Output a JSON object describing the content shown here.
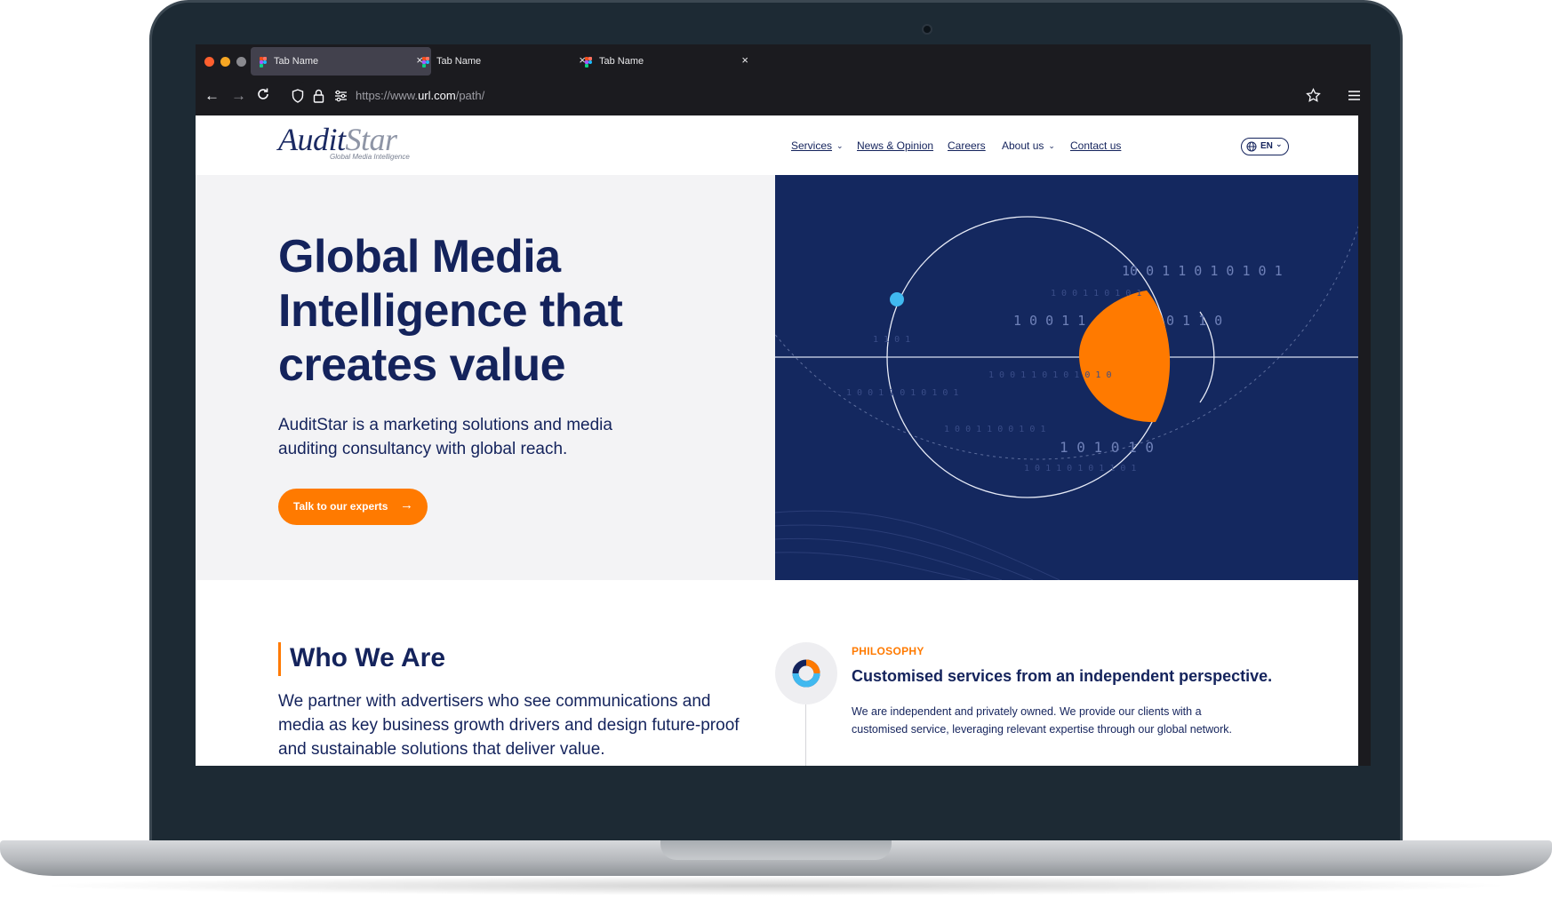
{
  "browser": {
    "tabs": [
      {
        "label": "Tab Name",
        "active": true
      },
      {
        "label": "Tab Name",
        "active": false
      },
      {
        "label": "Tab Name",
        "active": false
      }
    ],
    "close_glyph": "×",
    "url_prefix": "https://www.",
    "url_domain": "url.com",
    "url_path": "/path/",
    "traffic_lights": [
      "#ff5f2e",
      "#f6a623",
      "#8a8a8f"
    ]
  },
  "site": {
    "logo": {
      "main_a": "Audit",
      "main_b": "Star",
      "tagline": "Global Media Intelligence"
    },
    "nav": {
      "services": "Services",
      "news": "News & Opinion",
      "careers": "Careers",
      "about": "About us",
      "contact": "Contact us",
      "lang": "EN"
    },
    "hero": {
      "title": "Global Media Intelligence that creates value",
      "subtitle": "AuditStar is a marketing solutions and media auditing consultancy with global reach.",
      "cta": "Talk to our experts",
      "binary_rows": [
        "10 0 1  1 0  1 0 1 0 1",
        "1 0 0 1  1",
        "0 1   1     0",
        "1    0    1    0    1    0"
      ]
    },
    "who": {
      "title": "Who We Are",
      "text": "We partner with advertisers who see communications and media as key business growth drivers and design future-proof and sustainable solutions that deliver value."
    },
    "philosophy": {
      "kicker": "PHILOSOPHY",
      "title": "Customised services from an independent perspective.",
      "text": "We are independent and privately owned. We provide our clients with a customised service, leveraging relevant expertise through our global network."
    }
  },
  "colors": {
    "navy": "#14235c",
    "hero_bg": "#14285f",
    "orange": "#ff7a00",
    "cyan": "#40b9f0"
  }
}
